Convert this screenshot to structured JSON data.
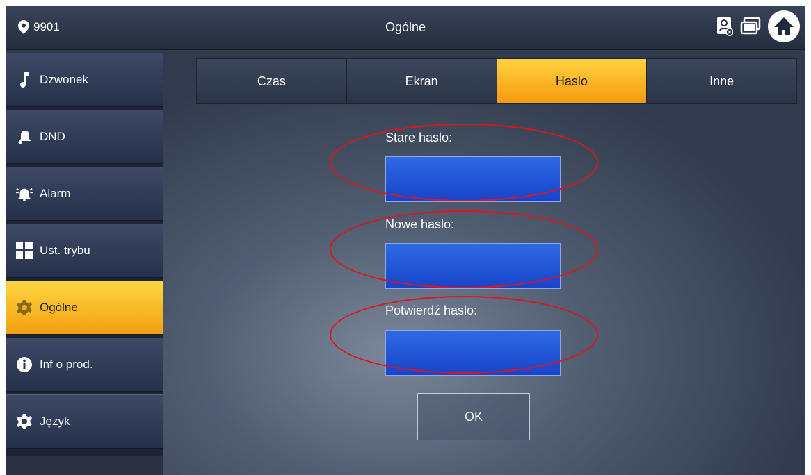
{
  "header": {
    "room_number": "9901",
    "title": "Ogólne",
    "icons": [
      "location-pin-icon",
      "monitor-status-icon",
      "network-status-icon",
      "home-icon"
    ]
  },
  "sidebar": {
    "items": [
      {
        "label": "Dzwonek",
        "icon": "music-note-icon",
        "active": false
      },
      {
        "label": "DND",
        "icon": "bell-icon",
        "active": false
      },
      {
        "label": "Alarm",
        "icon": "alarm-bell-icon",
        "active": false
      },
      {
        "label": "Ust. trybu",
        "icon": "mode-grid-icon",
        "active": false
      },
      {
        "label": "Ogólne",
        "icon": "gear-icon",
        "active": true
      },
      {
        "label": "Inf o prod.",
        "icon": "info-icon",
        "active": false
      },
      {
        "label": "Język",
        "icon": "gear-icon",
        "active": false
      }
    ]
  },
  "tabs": [
    {
      "label": "Czas",
      "active": false
    },
    {
      "label": "Ekran",
      "active": false
    },
    {
      "label": "Haslo",
      "active": true
    },
    {
      "label": "Inne",
      "active": false
    }
  ],
  "form": {
    "old_password_label": "Stare haslo:",
    "old_password_value": "",
    "new_password_label": "Nowe haslo:",
    "new_password_value": "",
    "confirm_password_label": "Potwierdź haslo:",
    "confirm_password_value": "",
    "ok_label": "OK"
  },
  "colors": {
    "active_accent": "#f7b21d",
    "input_blue": "#1f50d6",
    "highlight_ring": "#e0141a"
  }
}
